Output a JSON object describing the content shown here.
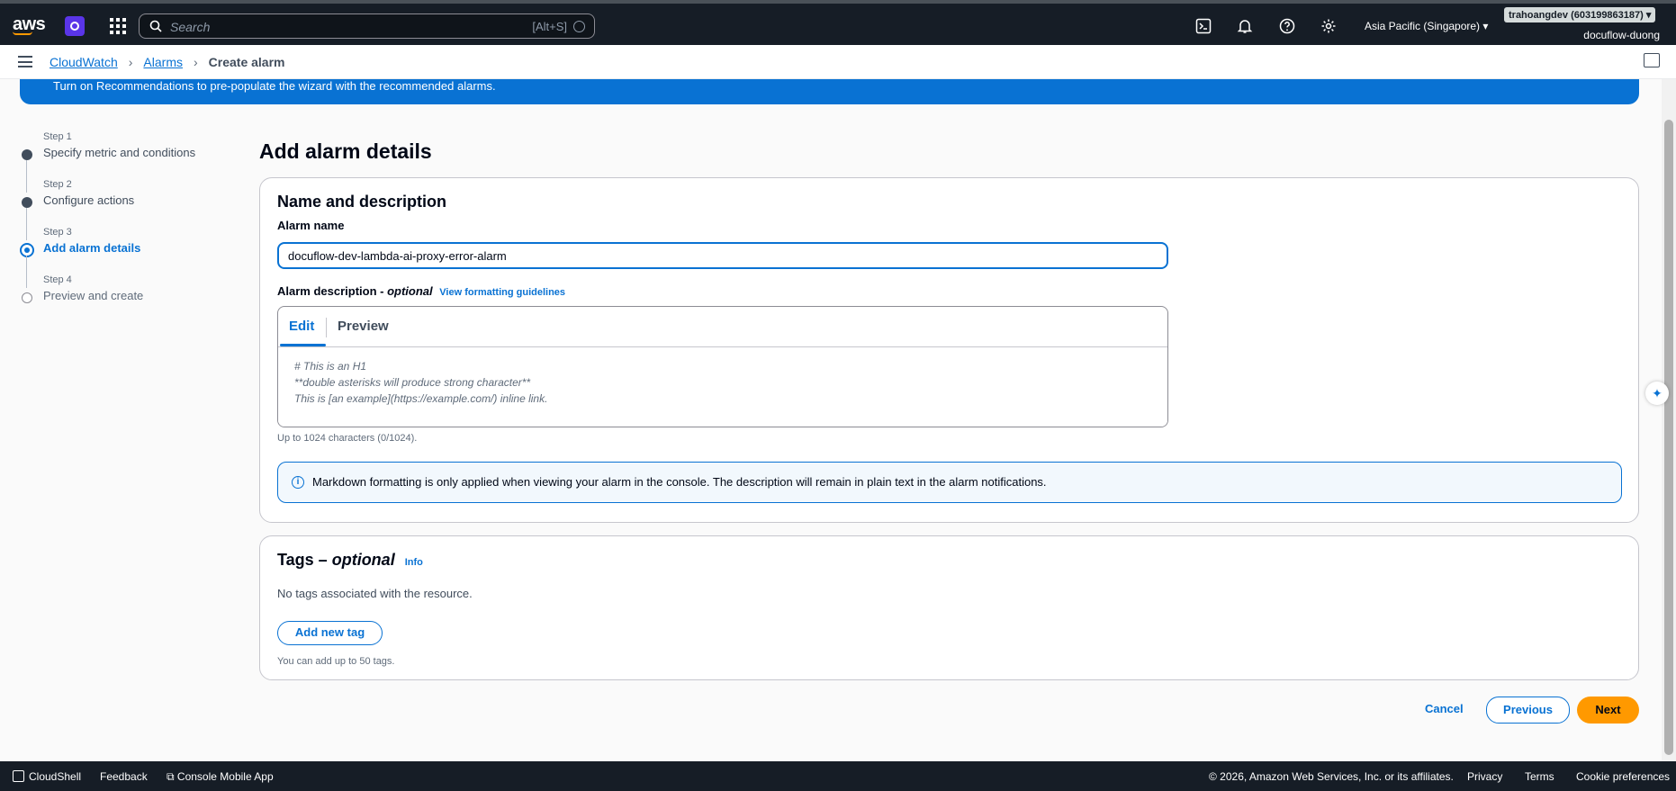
{
  "topnav": {
    "logo": "aws",
    "search_placeholder": "Search",
    "search_shortcut": "[Alt+S]",
    "region": "Asia Pacific (Singapore) ▾",
    "account_badge": "trahoangdev (603199863187) ▾",
    "account_name": "docuflow-duong",
    "icons": [
      "cloudshell-icon",
      "bell-icon",
      "help-icon",
      "gear-icon"
    ]
  },
  "breadcrumb": {
    "items": [
      "CloudWatch",
      "Alarms"
    ],
    "current": "Create alarm"
  },
  "banner": {
    "text": "Turn on Recommendations to pre-populate the wizard with the recommended alarms."
  },
  "steps": [
    {
      "num": "Step 1",
      "label": "Specify metric and conditions",
      "state": "done"
    },
    {
      "num": "Step 2",
      "label": "Configure actions",
      "state": "done"
    },
    {
      "num": "Step 3",
      "label": "Add alarm details",
      "state": "active"
    },
    {
      "num": "Step 4",
      "label": "Preview and create",
      "state": "pending"
    }
  ],
  "page_title": "Add alarm details",
  "name_section": {
    "title": "Name and description",
    "alarm_name_label": "Alarm name",
    "alarm_name_value": "docuflow-dev-lambda-ai-proxy-error-alarm",
    "desc_label": "Alarm description -",
    "desc_optional": "optional",
    "desc_link": "View formatting guidelines",
    "tab_edit": "Edit",
    "tab_preview": "Preview",
    "desc_placeholder": "# This is an H1\n**double asterisks will produce strong character**\nThis is [an example](https://example.com/) inline link.",
    "char_hint": "Up to 1024 characters (0/1024).",
    "alert_text": "Markdown formatting is only applied when viewing your alarm in the console. The description will remain in plain text in the alarm notifications."
  },
  "tags_section": {
    "title": "Tags –",
    "title_optional": "optional",
    "info": "Info",
    "empty_text": "No tags associated with the resource.",
    "add_button": "Add new tag",
    "limit_hint": "You can add up to 50 tags."
  },
  "actions": {
    "cancel": "Cancel",
    "previous": "Previous",
    "next": "Next"
  },
  "footer": {
    "cloudshell": "CloudShell",
    "feedback": "Feedback",
    "mobile_app": "Console Mobile App",
    "copyright": "© 2026, Amazon Web Services, Inc. or its affiliates.",
    "privacy": "Privacy",
    "terms": "Terms",
    "cookies": "Cookie preferences"
  },
  "colors": {
    "nav_bg": "#161d26",
    "link_blue": "#0972d3",
    "primary_orange": "#ff9900"
  }
}
